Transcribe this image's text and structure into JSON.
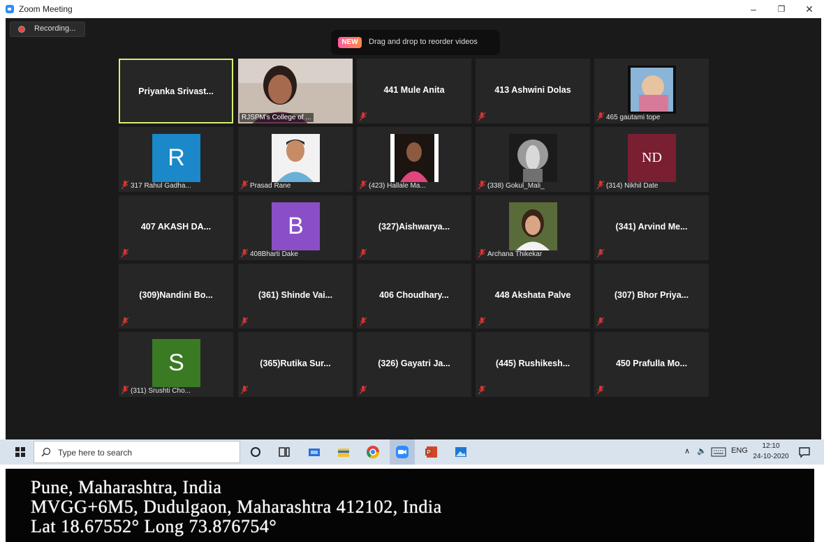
{
  "window": {
    "title": "Zoom Meeting",
    "minimize": "–",
    "maximize": "❐",
    "close": "✕"
  },
  "recording": {
    "label": "Recording..."
  },
  "toast": {
    "badge": "NEW",
    "message": "Drag and drop to reorder videos"
  },
  "tiles": [
    {
      "name": "Priyanka  Srivast...",
      "active": true
    },
    {
      "video_label": "RJSPM's College of ..."
    },
    {
      "name": "441 Mule Anita"
    },
    {
      "name": "413 Ashwini Dolas"
    },
    {
      "caption": "465 gautami tope"
    },
    {
      "caption": "317 Rahul Gadha...",
      "avatar_letter": "R",
      "avatar_color": "#1a88c9"
    },
    {
      "caption": "Prasad Rane"
    },
    {
      "caption": "(423) Hallale Ma..."
    },
    {
      "caption": "(338) Gokul_Mali_"
    },
    {
      "caption": "(314) Nikhil Date",
      "avatar_letter": "ND",
      "avatar_color": "#7a1e32"
    },
    {
      "name": "407 AKASH DA..."
    },
    {
      "caption": "408Bharti Dake",
      "avatar_letter": "B",
      "avatar_color": "#8a4fc7"
    },
    {
      "name": "(327)Aishwarya..."
    },
    {
      "caption": "Archana Thikekar"
    },
    {
      "name": "(341) Arvind Me..."
    },
    {
      "name": "(309)Nandini Bo..."
    },
    {
      "name": "(361) Shinde Vai..."
    },
    {
      "name": "406  Choudhary..."
    },
    {
      "name": "448 Akshata Palve"
    },
    {
      "name": "(307) Bhor Priya..."
    },
    {
      "caption": "(311) Srushti Cho...",
      "avatar_letter": "S",
      "avatar_color": "#3a7a23"
    },
    {
      "name": "(365)Rutika  Sur..."
    },
    {
      "name": "(326) Gayatri Ja..."
    },
    {
      "name": "(445)  Rushikesh..."
    },
    {
      "name": "450 Prafulla Mo..."
    }
  ],
  "taskbar": {
    "search_placeholder": "Type here to search",
    "language": "ENG",
    "time": "12:10",
    "date": "24-10-2020"
  },
  "geo_stamp": {
    "line1": "Pune, Maharashtra, India",
    "line2": "MVGG+6M5, Dudulgaon, Maharashtra 412102, India",
    "line3": "Lat 18.67552°    Long 73.876754°"
  }
}
